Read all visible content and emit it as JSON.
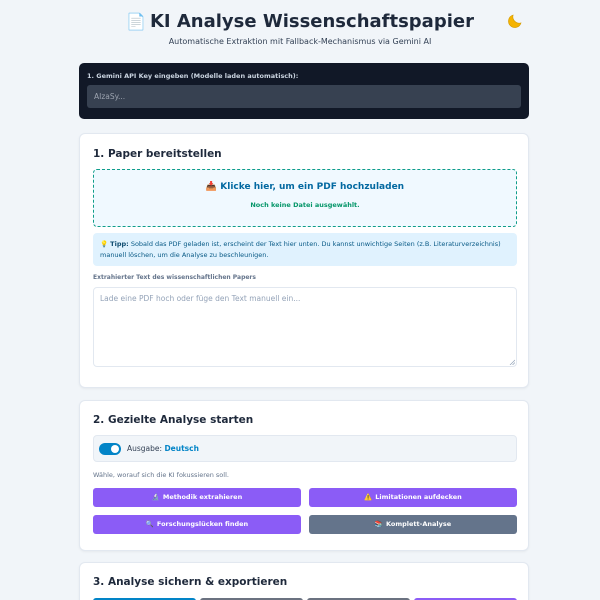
{
  "header": {
    "title": "KI Analyse Wissenschaftspapier",
    "subtitle": "Automatische Extraktion mit Fallback-Mechanismus via Gemini AI",
    "title_icon": "document-icon",
    "theme_icon": "moon-icon"
  },
  "api": {
    "label": "1. Gemini API Key eingeben (Modelle laden automatisch):",
    "placeholder": "AIzaSy..."
  },
  "section1": {
    "title": "1. Paper bereitstellen",
    "upload_icon": "📥",
    "upload_label": "Klicke hier, um ein PDF hochzuladen",
    "upload_status": "Noch keine Datei ausgewählt.",
    "tip_icon": "💡",
    "tip_bold": "Tipp:",
    "tip_text": " Sobald das PDF geladen ist, erscheint der Text hier unten. Du kannst unwichtige Seiten (z.B. Literaturverzeichnis) manuell löschen, um die Analyse zu beschleunigen.",
    "textarea_label": "Extrahierter Text des wissenschaftlichen Papers",
    "textarea_placeholder": "Lade eine PDF hoch oder füge den Text manuell ein..."
  },
  "section2": {
    "title": "2. Gezielte Analyse starten",
    "output_label": "Ausgabe: ",
    "output_language": "Deutsch",
    "toggle_on": true,
    "helper": "Wähle, worauf sich die KI fokussieren soll.",
    "buttons": [
      {
        "icon": "🔬",
        "label": "Methodik extrahieren"
      },
      {
        "icon": "⚠️",
        "label": "Limitationen aufdecken"
      },
      {
        "icon": "🔍",
        "label": "Forschungslücken finden"
      },
      {
        "icon": "📚",
        "label": "Komplett-Analyse"
      }
    ]
  },
  "section3": {
    "title": "3. Analyse sichern & exportieren"
  },
  "colors": {
    "accent_purple": "#8b5cf6",
    "accent_blue": "#0284c7",
    "api_bg": "#111827",
    "success_green": "#059669"
  }
}
